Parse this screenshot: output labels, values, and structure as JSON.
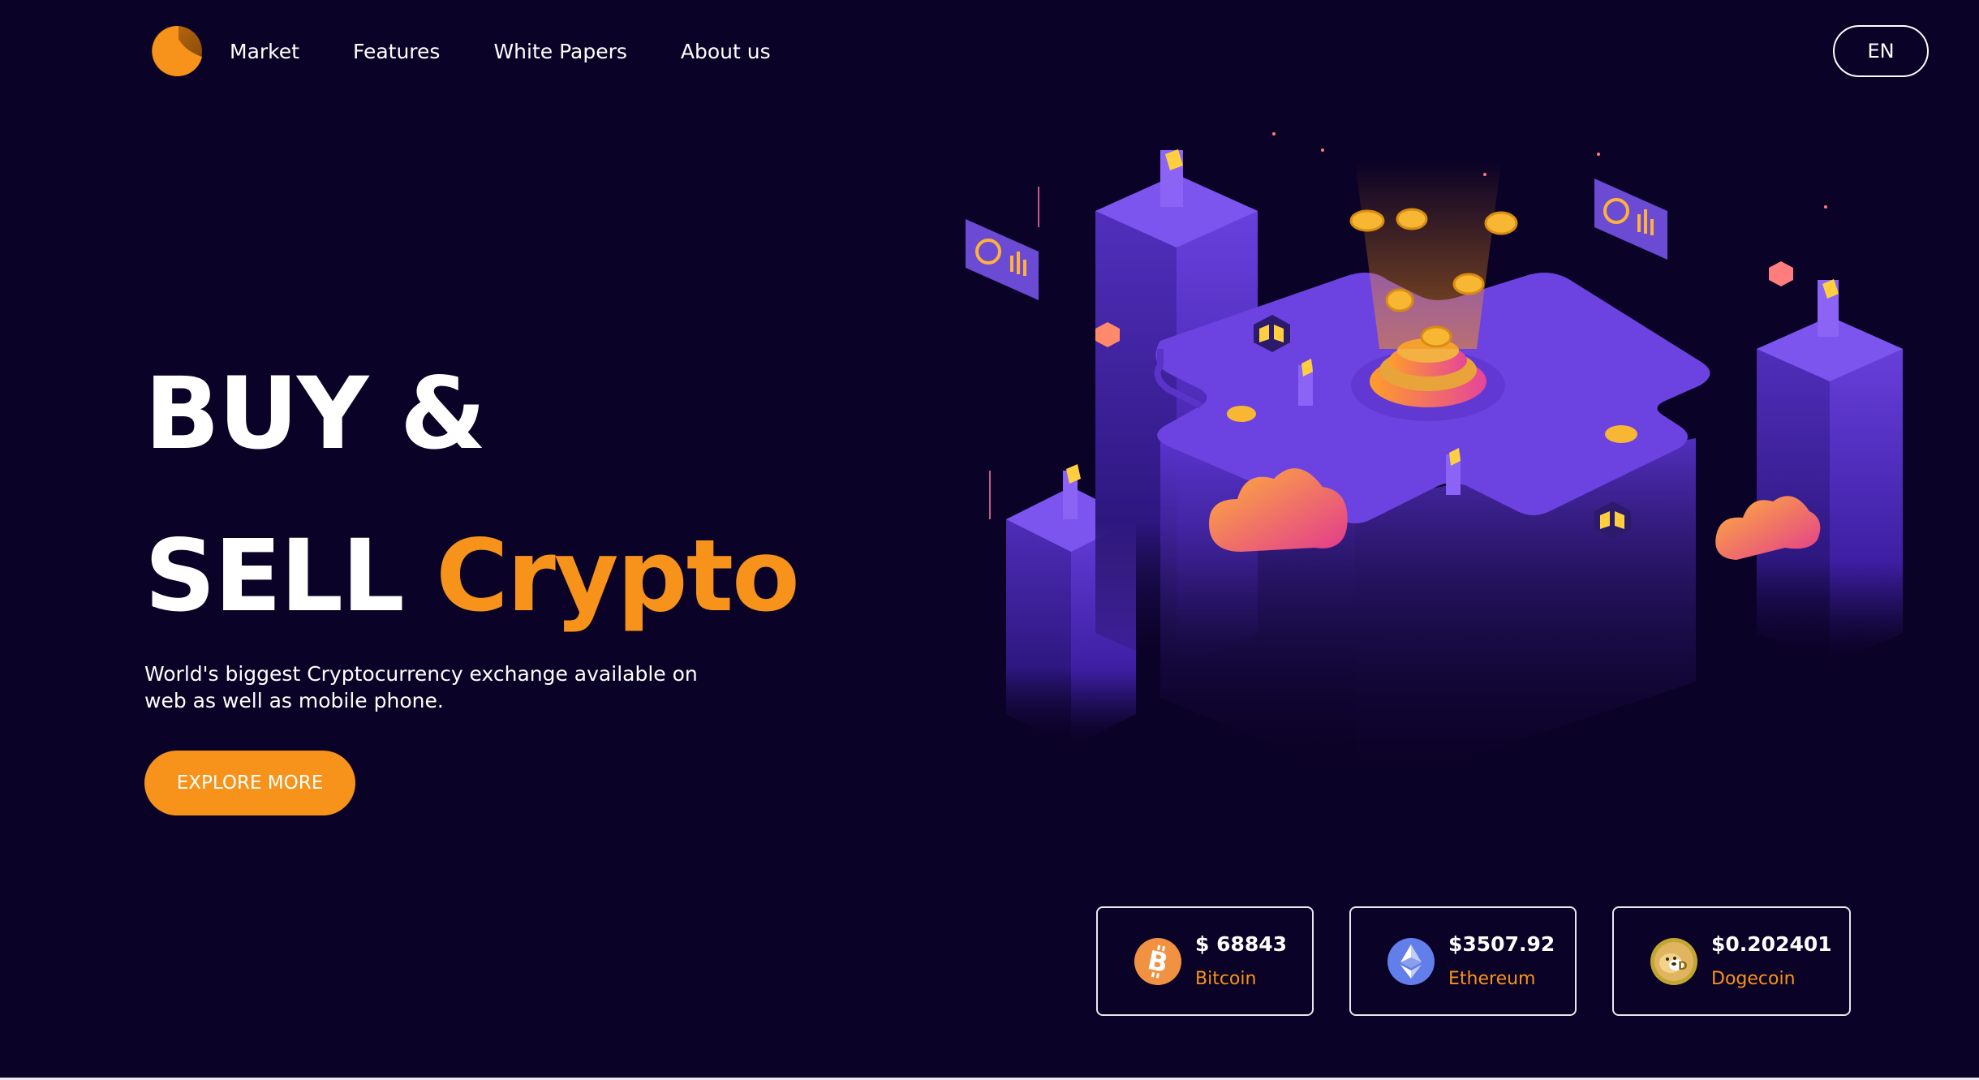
{
  "brand": {
    "logo_icon": "orange-crescent-logo"
  },
  "nav": {
    "items": [
      {
        "label": "Market"
      },
      {
        "label": "Features"
      },
      {
        "label": "White Papers"
      },
      {
        "label": "About us"
      }
    ]
  },
  "language": {
    "label": "EN"
  },
  "hero": {
    "title_line1": "BUY &",
    "title_line2_plain": "SELL ",
    "title_line2_accent": "Crypto",
    "description": "World's biggest Cryptocurrency exchange available on web as well as mobile phone.",
    "cta_label": "EXPLORE MORE"
  },
  "illustration": {
    "icon": "isometric-crypto-city-illustration"
  },
  "prices": [
    {
      "price": "$ 68843",
      "name": "Bitcoin",
      "icon": "bitcoin-icon"
    },
    {
      "price": "$3507.92",
      "name": "Ethereum",
      "icon": "ethereum-icon"
    },
    {
      "price": "$0.202401",
      "name": "Dogecoin",
      "icon": "dogecoin-icon"
    }
  ],
  "colors": {
    "background": "#0b0227",
    "accent": "#f7931a",
    "illustration_purple": "#6a3fe0",
    "ethereum_blue": "#627eea"
  }
}
